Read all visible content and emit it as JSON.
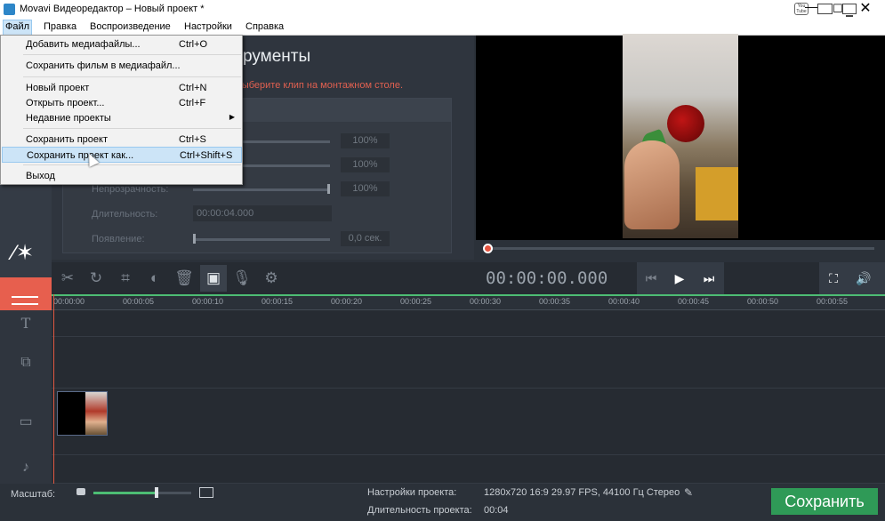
{
  "window": {
    "title": "Movavi Видеоредактор – Новый проект *",
    "controls": {
      "minimize": "—",
      "maximize": "☐",
      "close": "✕"
    },
    "youtube_icon_text": "You Tube"
  },
  "menubar": {
    "items": [
      "Файл",
      "Правка",
      "Воспроизведение",
      "Настройки",
      "Справка"
    ]
  },
  "file_menu": {
    "items": [
      {
        "label": "Добавить медиафайлы...",
        "shortcut": "Ctrl+O"
      },
      {
        "label": "Сохранить фильм в медиафайл...",
        "shortcut": ""
      },
      {
        "label": "Новый проект",
        "shortcut": "Ctrl+N"
      },
      {
        "label": "Открыть проект...",
        "shortcut": "Ctrl+F"
      },
      {
        "label": "Недавние проекты",
        "shortcut": "",
        "submenu": true
      },
      {
        "label": "Сохранить проект",
        "shortcut": "Ctrl+S"
      },
      {
        "label": "Сохранить проект как...",
        "shortcut": "Ctrl+Shift+S",
        "highlighted": true
      },
      {
        "label": "Выход",
        "shortcut": ""
      }
    ]
  },
  "tools_panel": {
    "title": "рументы",
    "hint": "выберите клип на монтажном столе.",
    "properties": [
      {
        "label": "",
        "value": "100%",
        "slider": 1.0
      },
      {
        "label": "",
        "value": "100%",
        "slider": 1.0
      },
      {
        "label": "Непрозрачность:",
        "value": "100%",
        "slider": 1.0
      },
      {
        "label": "Длительность:",
        "value": "00:00:04.000"
      },
      {
        "label": "Появление:",
        "value": "0,0 сек.",
        "slider": 0.0
      }
    ]
  },
  "toolbar": {
    "icons": [
      "scissors-icon",
      "rotate-icon",
      "crop-icon",
      "color-icon",
      "trash-icon",
      "image-icon",
      "microphone-icon",
      "gear-icon"
    ],
    "active_icon": "image-icon"
  },
  "player": {
    "timecode": "00:00:00.000",
    "position": 0.0
  },
  "ruler": {
    "ticks": [
      "00:00:00",
      "00:00:05",
      "00:00:10",
      "00:00:15",
      "00:00:20",
      "00:00:25",
      "00:00:30",
      "00:00:35",
      "00:00:40",
      "00:00:45",
      "00:00:50",
      "00:00:55"
    ]
  },
  "tracks": {
    "icons": [
      "text-track-icon",
      "overlay-track-icon",
      "video-track-icon",
      "audio-track-icon"
    ],
    "text_glyph": "T",
    "audio_glyph": "♪"
  },
  "bottom_bar": {
    "scale_label": "Масштаб:",
    "scale_level": 0.63,
    "settings_label": "Настройки проекта:",
    "settings_value": "1280x720 16:9 29.97 FPS, 44100 Гц Стерео",
    "duration_label": "Длительность проекта:",
    "duration_value": "00:04",
    "save_label": "Сохранить"
  },
  "colors": {
    "accent_red": "#e75f4e",
    "save_green": "#2f9a57",
    "timeline_green": "#4dbd74"
  }
}
